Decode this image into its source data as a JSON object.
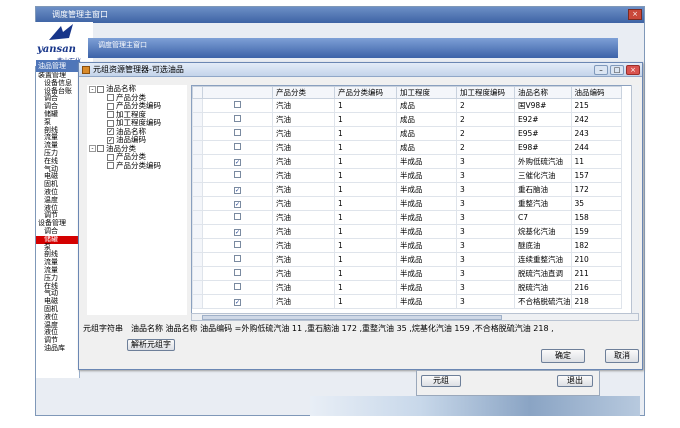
{
  "outer_window": {
    "title": "调度管理主窗口"
  },
  "logo": {
    "brand": "yansan",
    "sub": "燕山石化"
  },
  "second_window": {
    "title": "调度管理主窗口"
  },
  "left_tree": {
    "tab": "油品管理",
    "items": [
      "装置管理",
      "设备信息",
      "设备台账",
      "调合",
      "调合",
      "储罐",
      "泵",
      "剖线",
      "流量",
      "流量",
      "压力",
      "在线",
      "气动",
      "电磁",
      "固机",
      "液位",
      "温度",
      "液位",
      "调节",
      "设备管理",
      "调合",
      "储罐",
      "泵",
      "剖线",
      "流量",
      "流量",
      "压力",
      "在线",
      "气动",
      "电磁",
      "固机",
      "液位",
      "温度",
      "液位",
      "调节",
      "油品库"
    ],
    "highlight_index": 21
  },
  "dialog": {
    "title": "元组资源管理器-可选油品",
    "tree": [
      {
        "label": "油品名称",
        "level": 0,
        "checked": false,
        "expander": "-"
      },
      {
        "label": "产品分类",
        "level": 1,
        "checked": false
      },
      {
        "label": "产品分类编码",
        "level": 1,
        "checked": false
      },
      {
        "label": "加工程度",
        "level": 1,
        "checked": false
      },
      {
        "label": "加工程度编码",
        "level": 1,
        "checked": false
      },
      {
        "label": "油品名称",
        "level": 1,
        "checked": true
      },
      {
        "label": "油品编码",
        "level": 1,
        "checked": true
      },
      {
        "label": "油品分类",
        "level": 0,
        "checked": false,
        "expander": "-"
      },
      {
        "label": "产品分类",
        "level": 1,
        "checked": false
      },
      {
        "label": "产品分类编码",
        "level": 1,
        "checked": false
      }
    ],
    "columns": [
      "",
      "产品分类",
      "产品分类编码",
      "加工程度",
      "加工程度编码",
      "油品名称",
      "油品编码"
    ],
    "rows": [
      {
        "checked": false,
        "cells": [
          "汽油",
          "1",
          "成品",
          "2",
          "国V98#",
          "215"
        ]
      },
      {
        "checked": false,
        "cells": [
          "汽油",
          "1",
          "成品",
          "2",
          "E92#",
          "242"
        ]
      },
      {
        "checked": false,
        "cells": [
          "汽油",
          "1",
          "成品",
          "2",
          "E95#",
          "243"
        ]
      },
      {
        "checked": false,
        "cells": [
          "汽油",
          "1",
          "成品",
          "2",
          "E98#",
          "244"
        ]
      },
      {
        "checked": true,
        "cells": [
          "汽油",
          "1",
          "半成品",
          "3",
          "外购低硫汽油",
          "11"
        ]
      },
      {
        "checked": false,
        "cells": [
          "汽油",
          "1",
          "半成品",
          "3",
          "三催化汽油",
          "157"
        ]
      },
      {
        "checked": true,
        "cells": [
          "汽油",
          "1",
          "半成品",
          "3",
          "重石脑油",
          "172"
        ]
      },
      {
        "checked": true,
        "cells": [
          "汽油",
          "1",
          "半成品",
          "3",
          "重整汽油",
          "35"
        ]
      },
      {
        "checked": false,
        "cells": [
          "汽油",
          "1",
          "半成品",
          "3",
          "C7",
          "158"
        ]
      },
      {
        "checked": true,
        "cells": [
          "汽油",
          "1",
          "半成品",
          "3",
          "烷基化汽油",
          "159"
        ]
      },
      {
        "checked": false,
        "cells": [
          "汽油",
          "1",
          "半成品",
          "3",
          "醚底油",
          "182"
        ]
      },
      {
        "checked": false,
        "cells": [
          "汽油",
          "1",
          "半成品",
          "3",
          "连续重整汽油",
          "210"
        ]
      },
      {
        "checked": false,
        "cells": [
          "汽油",
          "1",
          "半成品",
          "3",
          "脱硫汽油直调",
          "211"
        ]
      },
      {
        "checked": false,
        "cells": [
          "汽油",
          "1",
          "半成品",
          "3",
          "脱硫汽油",
          "216"
        ]
      },
      {
        "checked": true,
        "cells": [
          "汽油",
          "1",
          "半成品",
          "3",
          "不合格脱硫汽油",
          "218"
        ]
      }
    ],
    "combo_label": "元组字符串",
    "combo_value": "油品名称  油品名称  油品编码  =外购低硫汽油 11 ,重石脑油 172 ,重整汽油 35 ,烷基化汽油 159 ,不合格脱硫汽油 218 ,",
    "parse_button": "解析元组字",
    "ok_button": "确定",
    "cancel_button": "取消"
  },
  "background_dialog": {
    "btn1": "元组",
    "btn2": "退出"
  }
}
